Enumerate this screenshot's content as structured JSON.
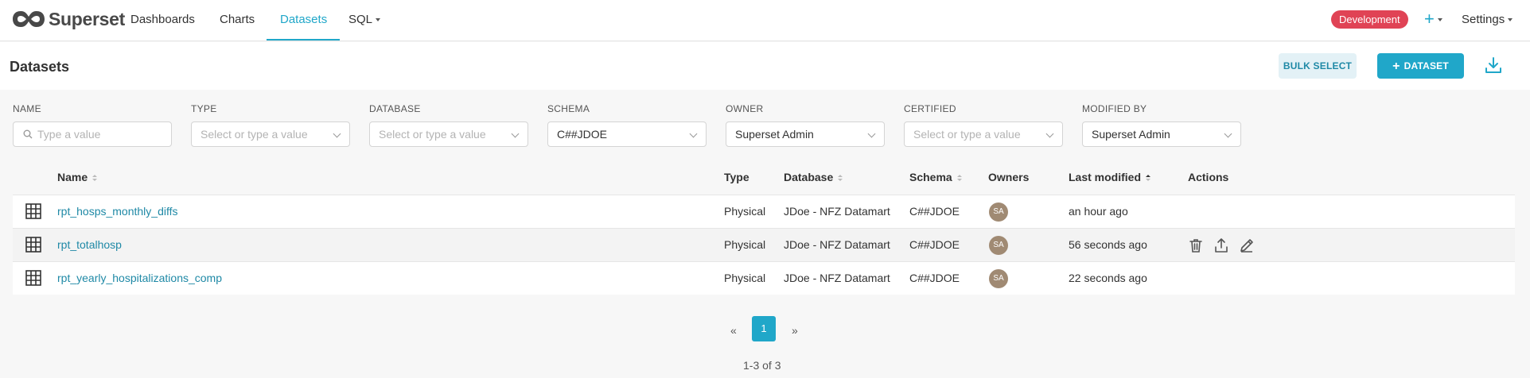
{
  "nav": {
    "brand": "Superset",
    "links": [
      "Dashboards",
      "Charts",
      "Datasets",
      "SQL"
    ],
    "active": "Datasets",
    "env_badge": "Development",
    "plus": "+",
    "settings": "Settings"
  },
  "header": {
    "title": "Datasets",
    "bulk_select": "BULK SELECT",
    "add_dataset": "DATASET",
    "add_icon": "+"
  },
  "filters": {
    "name": {
      "label": "NAME",
      "placeholder": "Type a value"
    },
    "type": {
      "label": "TYPE",
      "placeholder": "Select or type a value"
    },
    "database": {
      "label": "DATABASE",
      "placeholder": "Select or type a value"
    },
    "schema": {
      "label": "SCHEMA",
      "value": "C##JDOE"
    },
    "owner": {
      "label": "OWNER",
      "value": "Superset Admin"
    },
    "certified": {
      "label": "CERTIFIED",
      "placeholder": "Select or type a value"
    },
    "modified_by": {
      "label": "MODIFIED BY",
      "value": "Superset Admin"
    }
  },
  "table": {
    "columns": [
      "Name",
      "Type",
      "Database",
      "Schema",
      "Owners",
      "Last modified",
      "Actions"
    ],
    "rows": [
      {
        "name": "rpt_hosps_monthly_diffs",
        "type": "Physical",
        "database": "JDoe - NFZ Datamart",
        "schema": "C##JDOE",
        "owner": "SA",
        "modified": "an hour ago"
      },
      {
        "name": "rpt_totalhosp",
        "type": "Physical",
        "database": "JDoe - NFZ Datamart",
        "schema": "C##JDOE",
        "owner": "SA",
        "modified": "56 seconds ago"
      },
      {
        "name": "rpt_yearly_hospitalizations_comp",
        "type": "Physical",
        "database": "JDoe - NFZ Datamart",
        "schema": "C##JDOE",
        "owner": "SA",
        "modified": "22 seconds ago"
      }
    ]
  },
  "pagination": {
    "prev": "«",
    "current": "1",
    "next": "»",
    "count": "1-3 of 3"
  },
  "colors": {
    "accent": "#20a7c9",
    "link": "#1f89a6",
    "badge": "#e04355",
    "avatar": "#a08a73"
  },
  "icons": [
    "superset-logo-icon",
    "caret-down-icon",
    "download-icon",
    "search-icon",
    "chevron-down-icon",
    "sort-icon",
    "sort-asc-icon",
    "dataset-grid-icon",
    "trash-icon",
    "export-icon",
    "edit-icon"
  ]
}
